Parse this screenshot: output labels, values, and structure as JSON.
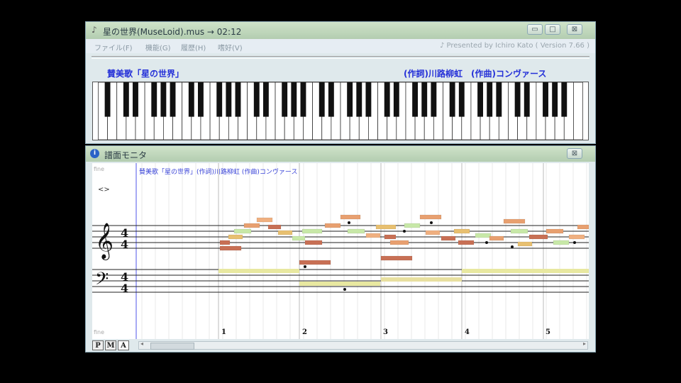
{
  "window_main": {
    "title": "星の世界(MuseLoid).mus → 02:12",
    "menu": [
      "ファイル(F)",
      "機能(G)",
      "履歴(H)",
      "嗜好(V)"
    ],
    "credits": "♪ Presented by Ichiro Kato ( Version 7.66 )",
    "song_title": "賛美歌「星の世界」",
    "song_author": "(作詞)川路柳虹　(作曲)コンヴァース",
    "controls": [
      "▭",
      "□",
      "⊠"
    ]
  },
  "window_score": {
    "title": "譜面モニタ",
    "caption": "賛美歌「星の世界」(作詞)川路柳虹 (作曲)コンヴァース",
    "top_label": "fine",
    "bottom_label": "fine",
    "tempo_mark": "<>",
    "time_signature": "4/4",
    "measures": [
      "1",
      "2",
      "3",
      "4",
      "5"
    ],
    "tabs": [
      "P",
      "M",
      "A"
    ],
    "close": "⊠"
  }
}
